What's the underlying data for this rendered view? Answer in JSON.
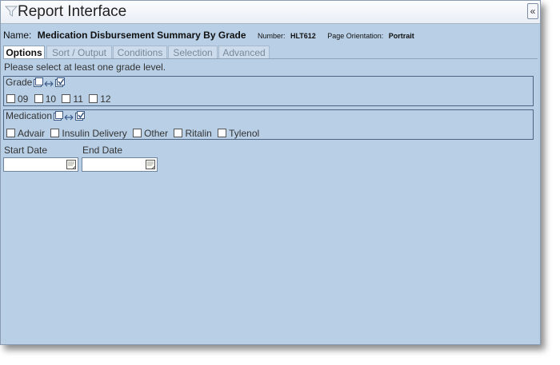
{
  "window": {
    "title": "Report Interface",
    "collapse_glyph": "«",
    "filter_icon": "funnel-icon"
  },
  "info": {
    "name_label": "Name:",
    "report_name": "Medication Disbursement Summary By Grade",
    "number_label": "Number:",
    "number_value": "HLT612",
    "orientation_label": "Page Orientation:",
    "orientation_value": "Portrait"
  },
  "tabs": [
    {
      "label": "Options",
      "active": true
    },
    {
      "label": "Sort / Output",
      "active": false
    },
    {
      "label": "Conditions",
      "active": false
    },
    {
      "label": "Selection",
      "active": false
    },
    {
      "label": "Advanced",
      "active": false
    }
  ],
  "hint": "Please select at least one grade level.",
  "grade": {
    "title": "Grade",
    "options": [
      "09",
      "10",
      "11",
      "12"
    ]
  },
  "medication": {
    "title": "Medication",
    "options": [
      "Advair",
      "Insulin Delivery",
      "Other",
      "Ritalin",
      "Tylenol"
    ]
  },
  "dates": {
    "start_label": "Start Date",
    "start_value": "",
    "end_label": "End Date",
    "end_value": ""
  },
  "colors": {
    "panel_bg": "#b8cfe6",
    "group_border": "#4c6584",
    "active_tab_bg": "#ffffff"
  }
}
